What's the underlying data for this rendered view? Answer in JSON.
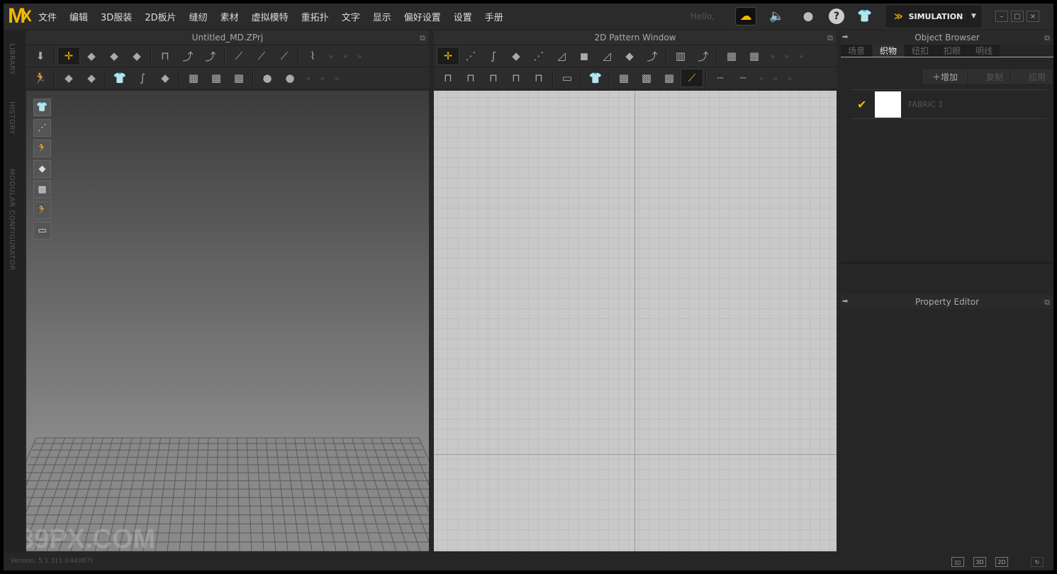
{
  "app": {
    "logo": "MD",
    "accent": "#f5b800"
  },
  "menu": [
    "文件",
    "编辑",
    "3D服装",
    "2D板片",
    "缝纫",
    "素材",
    "虚拟模特",
    "重拓扑",
    "文字",
    "显示",
    "偏好设置",
    "设置",
    "手册"
  ],
  "header": {
    "hello": "Hello,",
    "mode": "SIMULATION",
    "icons": [
      "cloud-icon",
      "speaker-icon",
      "user-icon",
      "help-icon",
      "add-garment-icon"
    ]
  },
  "left_strip": [
    "LIBRARY",
    "HISTORY",
    "MODULAR CONFIGURATOR"
  ],
  "panel3d": {
    "title": "Untitled_MD.ZPrj",
    "row1": [
      "simulate-icon",
      "|",
      "transform-pattern-icon",
      "edit-pattern-icon",
      "select-mesh-icon",
      "box-select-icon",
      "|",
      "strap-icon",
      "fold-icon",
      "fold-arrange-icon",
      "|",
      "pin-icon",
      "pin-box-icon",
      "pin-garment-icon",
      "|",
      "tack-icon"
    ],
    "row2": [
      "avatar-pose-icon",
      "|",
      "select-arrangement-icon",
      "arrange-brush-icon",
      "|",
      "measure-garment-icon",
      "edit-curve-icon",
      "puckering-icon",
      "|",
      "texture-icon",
      "select-fabric-icon",
      "fabric-checker-icon",
      "|",
      "button-icon",
      "button-solid-icon"
    ],
    "side_tools": [
      "garment-icon",
      "arrangement-points-icon",
      "avatar-icon",
      "pattern-icon",
      "fabric-icon",
      "avatar-head-icon",
      "environment-icon"
    ]
  },
  "panel2d": {
    "title": "2D Pattern Window",
    "row1": [
      "transform-pattern-2d-icon",
      "edit-point-icon",
      "edit-curve-point-icon",
      "curvature-icon",
      "add-point-icon",
      "polygon-icon",
      "rectangle-icon",
      "internal-polygon-icon",
      "trace-icon",
      "fold-pattern-icon",
      "|",
      "lay-out-icon",
      "unfold-icon",
      "|",
      "grid-select-icon",
      "grid-icon"
    ],
    "row2": [
      "segment-sewing-icon",
      "free-sewing-icon",
      "tuck-sewing-icon",
      "check-sewing-icon",
      "sewing-length-icon",
      "|",
      "iron-icon",
      "|",
      "garment-2d-icon",
      "|",
      "texture-2d-icon",
      "select-fabric-2d-icon",
      "fabric-checker-2d-icon",
      "show-pins-icon",
      "|",
      "topstitch-icon",
      "segment-topstitch-icon"
    ]
  },
  "object_browser": {
    "title": "Object Browser",
    "tabs": [
      "场景",
      "织物",
      "纽扣",
      "扣眼",
      "明线"
    ],
    "active_tab": 1,
    "buttons": {
      "add": "增加",
      "copy": "复制",
      "apply": "应用"
    },
    "items": [
      {
        "name": "FABRIC 1",
        "checked": true,
        "color": "#ffffff"
      }
    ]
  },
  "property_editor": {
    "title": "Property Editor"
  },
  "status": {
    "version": "Version: 5.1.311 (r44087)",
    "watermark": "39PX.COM",
    "view_buttons": [
      "split-view-icon",
      "3D",
      "2D",
      "refresh-icon"
    ]
  }
}
